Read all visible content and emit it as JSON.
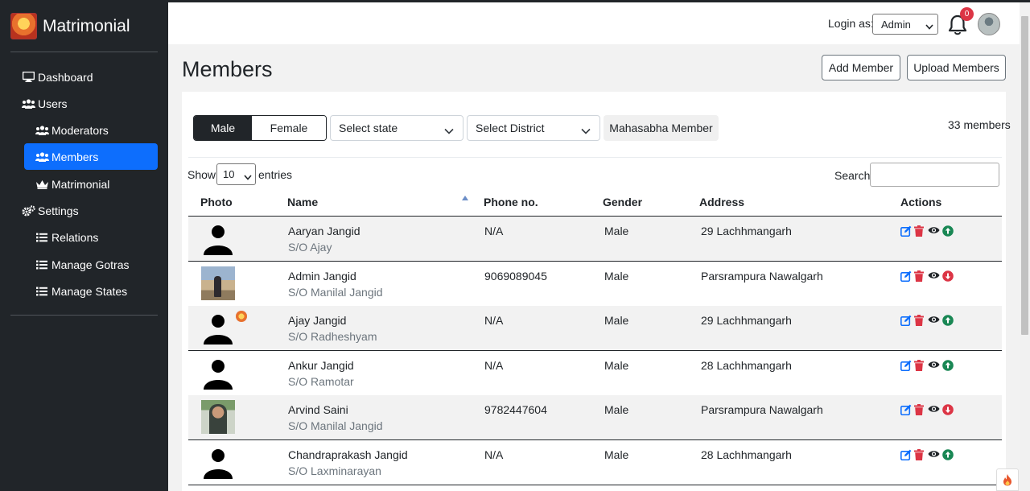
{
  "brand": {
    "name": "Matrimonial"
  },
  "sidebar": {
    "items": [
      {
        "label": "Dashboard"
      },
      {
        "label": "Users"
      },
      {
        "label": "Moderators"
      },
      {
        "label": "Members"
      },
      {
        "label": "Matrimonial"
      },
      {
        "label": "Settings"
      },
      {
        "label": "Relations"
      },
      {
        "label": "Manage Gotras"
      },
      {
        "label": "Manage States"
      }
    ],
    "active_item": "Members"
  },
  "header": {
    "login_label": "Login as:",
    "role_value": "Admin",
    "notification_count": "0"
  },
  "page": {
    "title": "Members",
    "add_label": "Add Member",
    "upload_label": "Upload Members"
  },
  "filters": {
    "male_label": "Male",
    "female_label": "Female",
    "state_placeholder": "Select state",
    "district_placeholder": "Select District",
    "mahasabha_label": "Mahasabha Member",
    "member_count": "33 members"
  },
  "datatable": {
    "show_label": "Show",
    "length_value": "10",
    "entries_label": "entries",
    "search_label": "Search:"
  },
  "table": {
    "headers": [
      "Photo",
      "Name",
      "Phone no.",
      "Gender",
      "Address",
      "Actions"
    ],
    "rows": [
      {
        "name": "Aaryan Jangid",
        "relation": "S/O Ajay",
        "phone": "N/A",
        "gender": "Male",
        "address": "29 Lachhmangarh",
        "photo": "silhouette",
        "toggle": "up"
      },
      {
        "name": "Admin Jangid",
        "relation": "S/O Manilal Jangid",
        "phone": "9069089045",
        "gender": "Male",
        "address": "Parsrampura Nawalgarh",
        "photo": "photo",
        "toggle": "down"
      },
      {
        "name": "Ajay Jangid",
        "relation": "S/O Radheshyam",
        "phone": "N/A",
        "gender": "Male",
        "address": "29 Lachhmangarh",
        "photo": "silhouette-badge",
        "toggle": "up"
      },
      {
        "name": "Ankur Jangid",
        "relation": "S/O Ramotar",
        "phone": "N/A",
        "gender": "Male",
        "address": "28 Lachhmangarh",
        "photo": "silhouette",
        "toggle": "up"
      },
      {
        "name": "Arvind Saini",
        "relation": "S/O Manilal Jangid",
        "phone": "9782447604",
        "gender": "Male",
        "address": "Parsrampura Nawalgarh",
        "photo": "photo",
        "toggle": "down"
      },
      {
        "name": "Chandraprakash Jangid",
        "relation": "S/O Laxminarayan",
        "phone": "N/A",
        "gender": "Male",
        "address": "28 Lachhmangarh",
        "photo": "silhouette",
        "toggle": "up"
      }
    ]
  },
  "colors": {
    "sidebar_bg": "#212529",
    "active_nav": "#0d6efd",
    "edit_icon": "#0d6efd",
    "delete_icon": "#dc3545",
    "up_icon": "#198754",
    "down_icon": "#dc3545",
    "badge": "#dc3545"
  },
  "icons": [
    "desktop-icon",
    "users-icon",
    "crown-icon",
    "gears-icon",
    "list-icon",
    "bell-icon",
    "edit-icon",
    "trash-icon",
    "eye-icon",
    "arrow-up-circle-icon",
    "arrow-down-circle-icon",
    "fire-icon"
  ]
}
